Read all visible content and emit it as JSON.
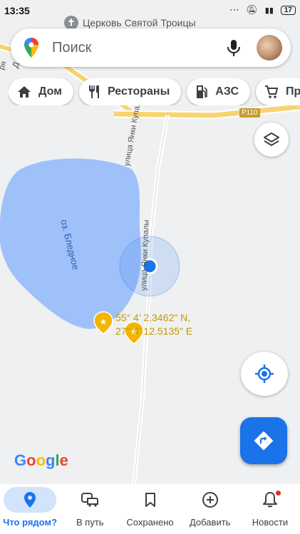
{
  "status_bar": {
    "time": "13:35",
    "battery": "17"
  },
  "map": {
    "top_place_label": "Церковь Святой Троицы",
    "road_label": "Р110",
    "street_label_upper": "улица Янки Купалы",
    "street_label_lower": "улица Янки Купалы",
    "lake_label": "оз. Бледное",
    "pin_label_line1": "55° 4' 2.3462\" N,",
    "pin_label_line2": "27° 4' 12.5135\" E",
    "edge_label_left": "ря",
    "edge_label_left2": "Д",
    "google_logo": "Google"
  },
  "search": {
    "placeholder": "Поиск"
  },
  "chips": [
    {
      "label": "Дом",
      "icon": "home-icon"
    },
    {
      "label": "Рестораны",
      "icon": "restaurant-icon"
    },
    {
      "label": "АЗС",
      "icon": "gas-station-icon"
    },
    {
      "label": "Пр",
      "icon": "shopping-cart-icon"
    }
  ],
  "bottom_nav": [
    {
      "label": "Что рядом?",
      "icon": "explore-pin-icon",
      "active": true
    },
    {
      "label": "В путь",
      "icon": "commute-icon"
    },
    {
      "label": "Сохранено",
      "icon": "bookmark-icon"
    },
    {
      "label": "Добавить",
      "icon": "add-circle-icon"
    },
    {
      "label": "Новости",
      "icon": "bell-icon"
    }
  ],
  "colors": {
    "accent": "#1a73e8",
    "lake": "#9fc1f9",
    "road": "#f7d372",
    "pin": "#f2b600",
    "map_bg": "#eef0f1"
  }
}
